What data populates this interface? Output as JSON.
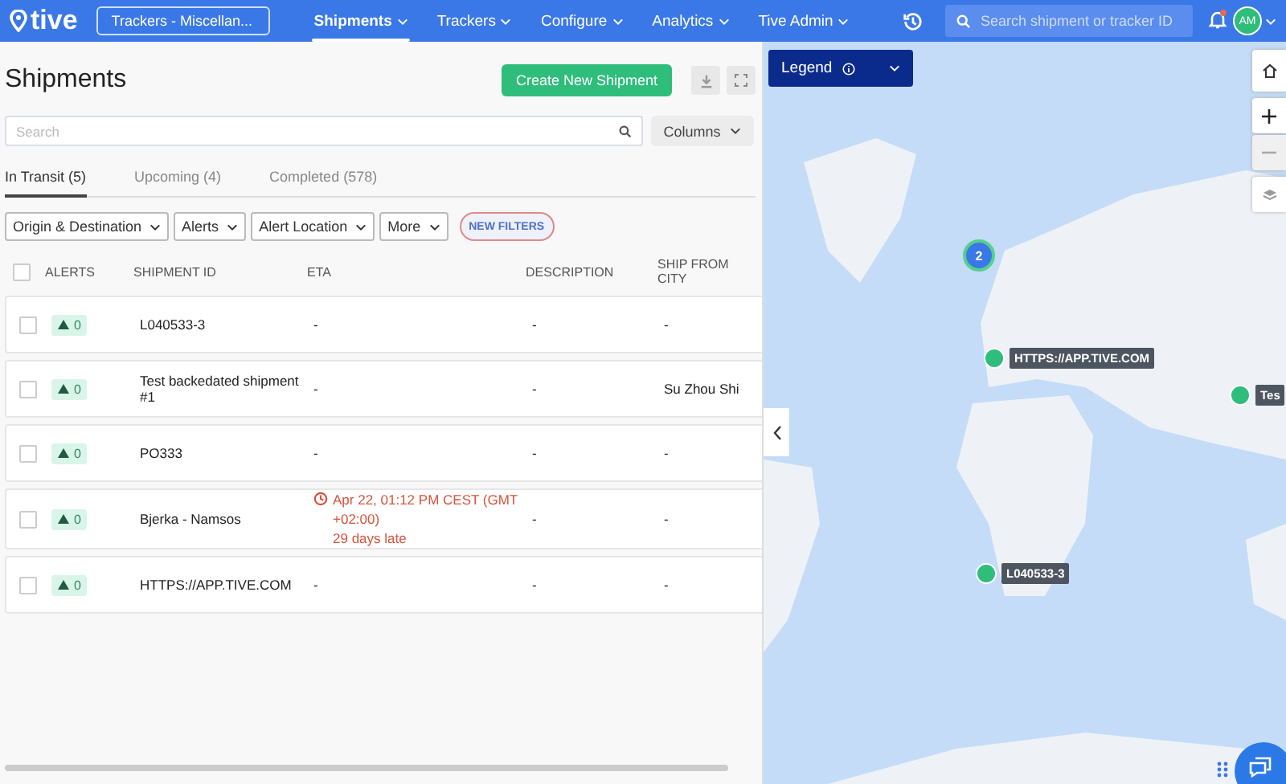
{
  "nav": {
    "logo": "tive",
    "org_selector": "Trackers - Miscellan...",
    "menu": [
      {
        "label": "Shipments",
        "selected": true
      },
      {
        "label": "Trackers",
        "selected": false
      },
      {
        "label": "Configure",
        "selected": false
      },
      {
        "label": "Analytics",
        "selected": false
      },
      {
        "label": "Tive Admin",
        "selected": false
      }
    ],
    "search": {
      "placeholder": "Search shipment or tracker ID"
    },
    "avatar": "AM",
    "notification": true
  },
  "page": {
    "title": "Shipments",
    "create_button": "Create New Shipment",
    "search": {
      "placeholder": "Search"
    },
    "columns_button": "Columns",
    "tabs": [
      {
        "label": "In Transit (5)",
        "selected": true
      },
      {
        "label": "Upcoming (4)",
        "selected": false
      },
      {
        "label": "Completed (578)",
        "selected": false
      }
    ],
    "filters": [
      "Origin & Destination",
      "Alerts",
      "Alert Location",
      "More"
    ],
    "new_filters": "NEW FILTERS"
  },
  "table": {
    "select_all": false,
    "columns": [
      "ALERTS",
      "SHIPMENT ID",
      "ETA",
      "DESCRIPTION",
      "SHIP FROM CITY"
    ],
    "rows": [
      {
        "checked": false,
        "alerts": "0",
        "shipment_id": "L040533-3",
        "eta": "-",
        "late": false,
        "description": "-",
        "ship_from_city": "-"
      },
      {
        "checked": false,
        "alerts": "0",
        "shipment_id": "Test backedated shipment #1",
        "eta": "-",
        "late": false,
        "description": "-",
        "ship_from_city": "Su Zhou Shi"
      },
      {
        "checked": false,
        "alerts": "0",
        "shipment_id": "PO333",
        "eta": "-",
        "late": false,
        "description": "-",
        "ship_from_city": "-"
      },
      {
        "checked": false,
        "alerts": "0",
        "shipment_id": "Bjerka - Namsos",
        "eta": "Apr 22, 01:12 PM CEST (GMT +02:00)",
        "late": true,
        "late_note": "29 days late",
        "description": "-",
        "ship_from_city": "-"
      },
      {
        "checked": false,
        "alerts": "0",
        "shipment_id": "HTTPS://APP.TIVE.COM",
        "eta": "-",
        "late": false,
        "description": "-",
        "ship_from_city": "-"
      }
    ]
  },
  "map": {
    "legend": "Legend",
    "cluster": "2",
    "markers": [
      {
        "label": "HTTPS://APP.TIVE.COM"
      },
      {
        "label": "Tes"
      },
      {
        "label": "L040533-3"
      }
    ]
  }
}
